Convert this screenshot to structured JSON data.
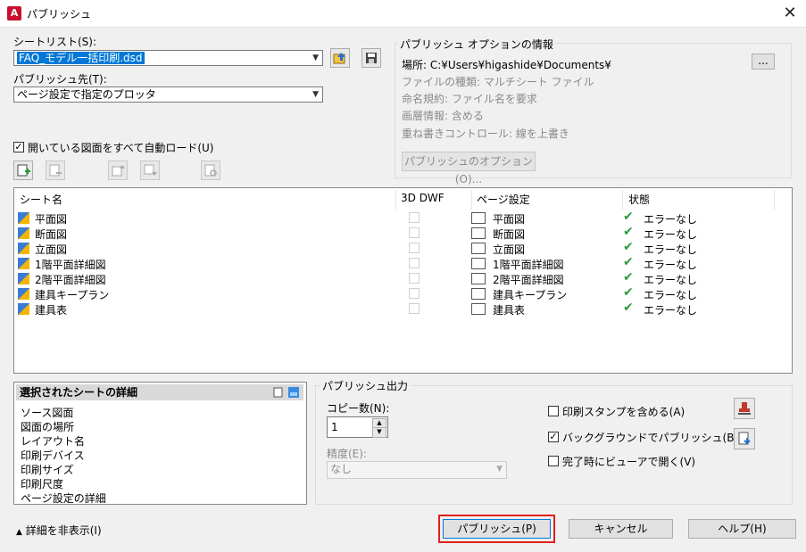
{
  "window": {
    "title": "パブリッシュ",
    "app_icon": "A"
  },
  "sheet_list_label": "シートリスト(S):",
  "sheet_list_value": "FAQ_モデル一括印刷.dsd",
  "publish_to_label": "パブリッシュ先(T):",
  "publish_to_value": "ページ設定で指定のプロッタ",
  "auto_load_label": "開いている図面をすべて自動ロード(U)",
  "options_info": {
    "title": "パブリッシュ オプションの情報",
    "location": "場所: C:¥Users¥higashide¥Documents¥",
    "file_type": "ファイルの種類: マルチシート ファイル",
    "naming": "命名規約: ファイル名を要求",
    "layer_info": "画層情報: 含める",
    "overwrite": "重ね書きコントロール: 線を上書き",
    "browse_label": "...",
    "options_button": "パブリッシュのオプション(O)..."
  },
  "table": {
    "headers": {
      "sheet": "シート名",
      "dwf": "3D DWF",
      "page_setup": "ページ設定",
      "status": "状態"
    },
    "rows": [
      {
        "sheet": "平面図",
        "page_setup": "平面図",
        "status": "エラーなし"
      },
      {
        "sheet": "断面図",
        "page_setup": "断面図",
        "status": "エラーなし"
      },
      {
        "sheet": "立面図",
        "page_setup": "立面図",
        "status": "エラーなし"
      },
      {
        "sheet": "1階平面詳細図",
        "page_setup": "1階平面詳細図",
        "status": "エラーなし"
      },
      {
        "sheet": "2階平面詳細図",
        "page_setup": "2階平面詳細図",
        "status": "エラーなし"
      },
      {
        "sheet": "建具キープラン",
        "page_setup": "建具キープラン",
        "status": "エラーなし"
      },
      {
        "sheet": "建具表",
        "page_setup": "建具表",
        "status": "エラーなし"
      }
    ]
  },
  "details": {
    "title": "選択されたシートの詳細",
    "items": [
      "ソース図面",
      "図面の場所",
      "レイアウト名",
      "印刷デバイス",
      "印刷サイズ",
      "印刷尺度",
      "ページ設定の詳細"
    ]
  },
  "publish_output": {
    "title": "パブリッシュ出力",
    "copies_label": "コピー数(N):",
    "copies_value": "1",
    "precision_label": "精度(E):",
    "precision_value": "なし",
    "include_stamp": "印刷スタンプを含める(A)",
    "background": "バックグラウンドでパブリッシュ(B)",
    "open_viewer": "完了時にビューアで開く(V)"
  },
  "footer": {
    "hide_details": "詳細を非表示(I)",
    "publish": "パブリッシュ(P)",
    "cancel": "キャンセル",
    "help": "ヘルプ(H)"
  },
  "colors": {
    "accent": "#0078d7",
    "highlight_border": "#e0201c",
    "ok_check": "#2e9b3c",
    "app_red": "#c8102e"
  }
}
